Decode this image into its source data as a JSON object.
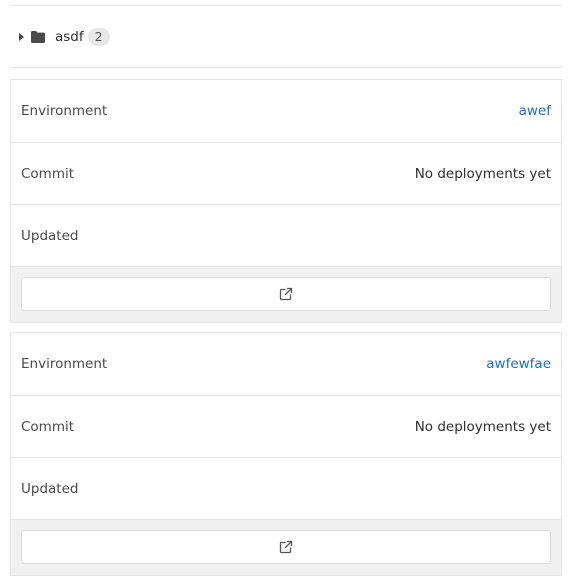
{
  "folder": {
    "name": "asdf",
    "count": "2",
    "icons": [
      "caret-right-icon",
      "folder-icon"
    ]
  },
  "environments": [
    {
      "environment_label": "Environment",
      "environment_name": "awef",
      "commit_label": "Commit",
      "commit_value": "No deployments yet",
      "updated_label": "Updated",
      "updated_value": "",
      "open_icon": "external-link-icon"
    },
    {
      "environment_label": "Environment",
      "environment_name": "awfewfae",
      "commit_label": "Commit",
      "commit_value": "No deployments yet",
      "updated_label": "Updated",
      "updated_value": "",
      "open_icon": "external-link-icon"
    }
  ],
  "colors": {
    "link": "#1f6dbf",
    "border": "#e5e5e5",
    "footer_bg": "#f0f0f0",
    "badge_bg": "#e8e8e8"
  }
}
